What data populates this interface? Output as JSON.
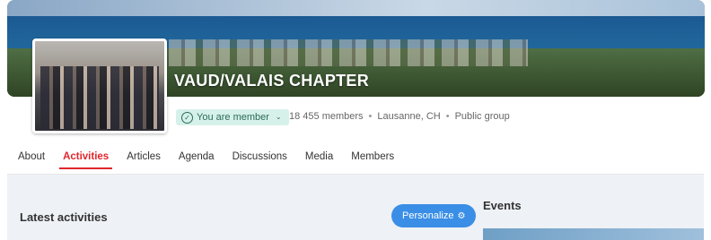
{
  "group": {
    "title": "VAUD/VALAIS CHAPTER",
    "membership_status": "You are member",
    "members": "18 455 members",
    "location": "Lausanne, CH",
    "visibility": "Public group",
    "separator": "•"
  },
  "tabs": [
    {
      "label": "About"
    },
    {
      "label": "Activities"
    },
    {
      "label": "Articles"
    },
    {
      "label": "Agenda"
    },
    {
      "label": "Discussions"
    },
    {
      "label": "Media"
    },
    {
      "label": "Members"
    }
  ],
  "main": {
    "latest_activities_label": "Latest activities",
    "personalize_label": "Personalize"
  },
  "sidebar": {
    "events_label": "Events"
  },
  "icons": {
    "check": "check-circle-icon",
    "chevron": "chevron-down-icon",
    "gear": "gear-icon"
  },
  "colors": {
    "accent_red": "#e0262d",
    "member_badge_bg": "#d6f1ea",
    "personalize_blue": "#3a8ee6"
  }
}
